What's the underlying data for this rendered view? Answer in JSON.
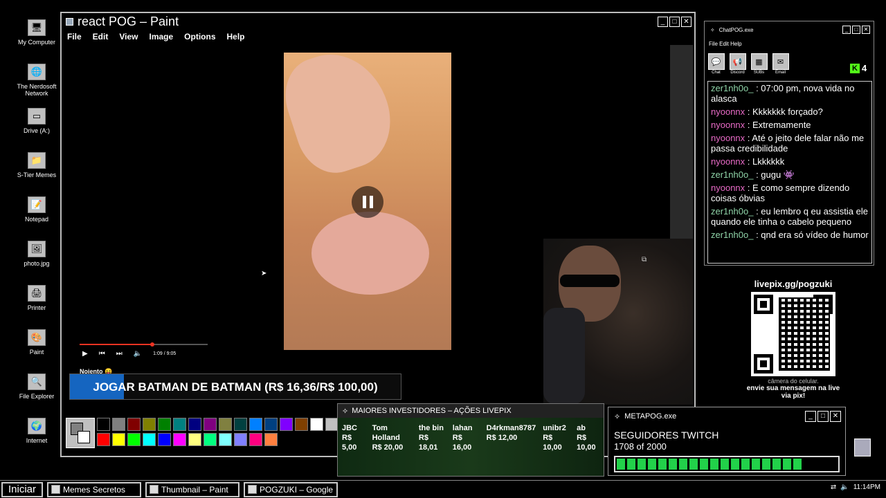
{
  "desktop": {
    "icons": [
      {
        "label": "My Computer",
        "icon": "computer-icon"
      },
      {
        "label": "The Nerdosoft Network",
        "icon": "network-icon"
      },
      {
        "label": "Drive (A:)",
        "icon": "drive-icon"
      },
      {
        "label": "S-Tier Memes",
        "icon": "folder-icon"
      },
      {
        "label": "Notepad",
        "icon": "notepad-icon"
      },
      {
        "label": "photo.jpg",
        "icon": "image-icon"
      },
      {
        "label": "Printer",
        "icon": "printer-icon"
      },
      {
        "label": "Paint",
        "icon": "paint-icon"
      },
      {
        "label": "File Explorer",
        "icon": "explorer-icon"
      },
      {
        "label": "Internet",
        "icon": "globe-icon"
      }
    ]
  },
  "paint": {
    "title": "react POG – Paint",
    "menu": [
      "File",
      "Edit",
      "View",
      "Image",
      "Options",
      "Help"
    ],
    "video": {
      "time": "1:09 / 9:05",
      "progress": 0.57,
      "caption": "Nojento 😝"
    },
    "colors": [
      "#000000",
      "#808080",
      "#800000",
      "#808000",
      "#008000",
      "#008080",
      "#000080",
      "#800080",
      "#808040",
      "#004040",
      "#0080ff",
      "#004080",
      "#8000ff",
      "#804000",
      "#ffffff",
      "#c0c0c0",
      "#ff0000",
      "#ffff00",
      "#00ff00",
      "#00ffff",
      "#0000ff",
      "#ff00ff",
      "#ffff80",
      "#00ff80",
      "#80ffff",
      "#8080ff",
      "#ff0080",
      "#ff8040"
    ]
  },
  "goal": {
    "text": "JOGAR BATMAN DE BATMAN (R$ 16,36/R$ 100,00)",
    "progress": 0.1636
  },
  "investors": {
    "title": "MAIORES INVESTIDORES – AÇÕES LIVEPIX",
    "items": [
      {
        "name": "JBC",
        "amount": "R$ 5,00"
      },
      {
        "name": "Tom Holland",
        "amount": "R$ 20,00"
      },
      {
        "name": "the bin",
        "amount": "R$ 18,01"
      },
      {
        "name": "lahan",
        "amount": "R$ 16,00"
      },
      {
        "name": "D4rkman8787",
        "amount": "R$ 12,00"
      },
      {
        "name": "unibr2",
        "amount": "R$ 10,00"
      },
      {
        "name": "ab",
        "amount": "R$ 10,00"
      }
    ]
  },
  "metapog": {
    "title": "METAPOG.exe",
    "label": "SEGUIDORES TWITCH",
    "count": "1708 of 2000",
    "progress": 0.854,
    "bar_color": "#22d14a"
  },
  "chat": {
    "title": "ChatPOG.exe",
    "menu": "File Edit Help",
    "tools": [
      {
        "label": "Chat",
        "icon": "chat-icon"
      },
      {
        "label": "Discord",
        "icon": "megaphone-icon"
      },
      {
        "label": "SUBs",
        "icon": "subs-icon"
      },
      {
        "label": "Email",
        "icon": "email-icon"
      }
    ],
    "kick_viewers": "4",
    "messages": [
      {
        "user": "zer1nh0o_",
        "sep": " : ",
        "text": "07:00 pm, nova vida no alasca",
        "color": "green"
      },
      {
        "user": "nyoonnx",
        "sep": " : ",
        "text": "Kkkkkkk forçado?",
        "color": "pink"
      },
      {
        "user": "nyoonnx",
        "sep": " : ",
        "text": "Extremamente",
        "color": "pink"
      },
      {
        "user": "nyoonnx",
        "sep": " : ",
        "text": "Até o jeito dele falar não me passa credibilidade",
        "color": "pink"
      },
      {
        "user": "nyoonnx",
        "sep": " : ",
        "text": "Lkkkkkk",
        "color": "pink"
      },
      {
        "user": "zer1nh0o_",
        "sep": " : ",
        "text": "gugu 👾",
        "color": "green"
      },
      {
        "user": "nyoonnx",
        "sep": " : ",
        "text": "E como sempre dizendo coisas óbvias",
        "color": "pink"
      },
      {
        "user": "zer1nh0o_",
        "sep": " : ",
        "text": "eu lembro q eu assistia ele quando ele tinha o cabelo pequeno",
        "color": "green"
      },
      {
        "user": "zer1nh0o_",
        "sep": " : ",
        "text": "qnd era só vídeo de humor",
        "color": "green"
      }
    ]
  },
  "livepix": {
    "url": "livepix.gg/pogzuki",
    "camera_text": "câmera do celular.",
    "message": "envie sua mensagem na live via pix!"
  },
  "taskbar": {
    "start": "Iniciar",
    "tasks": [
      "Memes Secretos",
      "Thumbnail – Paint",
      "POGZUKI – Google"
    ],
    "clock": "11:14PM"
  }
}
